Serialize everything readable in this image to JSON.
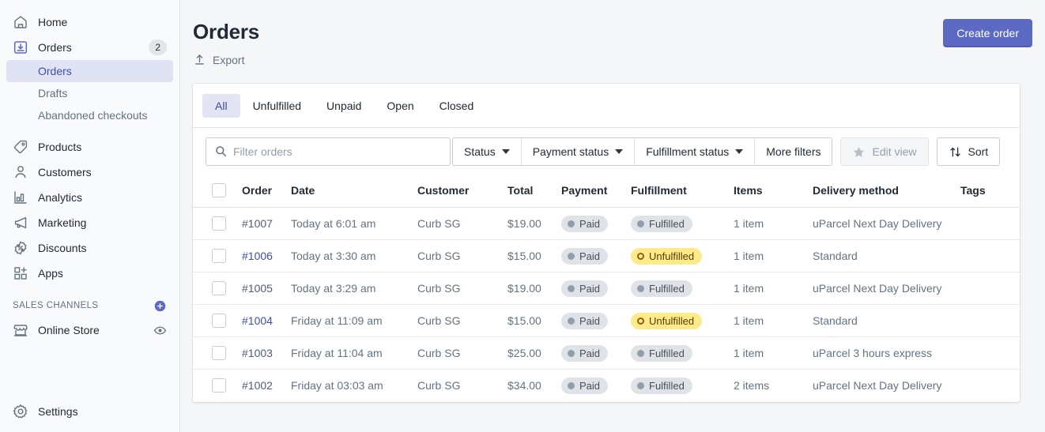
{
  "sidebar": {
    "items": [
      {
        "id": "home",
        "label": "Home",
        "icon": "home-icon",
        "badge": null
      },
      {
        "id": "orders",
        "label": "Orders",
        "icon": "orders-icon",
        "badge": "2"
      },
      {
        "id": "products",
        "label": "Products",
        "icon": "tag-icon",
        "badge": null
      },
      {
        "id": "customers",
        "label": "Customers",
        "icon": "person-icon",
        "badge": null
      },
      {
        "id": "analytics",
        "label": "Analytics",
        "icon": "bar-chart-icon",
        "badge": null
      },
      {
        "id": "marketing",
        "label": "Marketing",
        "icon": "megaphone-icon",
        "badge": null
      },
      {
        "id": "discounts",
        "label": "Discounts",
        "icon": "discount-icon",
        "badge": null
      },
      {
        "id": "apps",
        "label": "Apps",
        "icon": "apps-icon",
        "badge": null
      }
    ],
    "sub_items": [
      {
        "id": "orders",
        "label": "Orders",
        "active": true
      },
      {
        "id": "drafts",
        "label": "Drafts",
        "active": false
      },
      {
        "id": "abandoned",
        "label": "Abandoned checkouts",
        "active": false
      }
    ],
    "sales_channels": {
      "heading": "SALES CHANNELS",
      "add_icon": "plus-circle-icon",
      "items": [
        {
          "id": "online-store",
          "label": "Online Store",
          "icon": "store-icon",
          "action_icon": "eye-icon"
        }
      ]
    },
    "settings": {
      "label": "Settings",
      "icon": "gear-icon"
    },
    "colors": {
      "active_bg": "#dfe3f3",
      "active_text": "#3d4eac",
      "bg": "#f9fafb"
    }
  },
  "header": {
    "title": "Orders",
    "export_label": "Export",
    "export_icon": "export-icon",
    "create_order_label": "Create order",
    "primary_color": "#5c6ac4"
  },
  "tabs": [
    {
      "label": "All",
      "active": true
    },
    {
      "label": "Unfulfilled",
      "active": false
    },
    {
      "label": "Unpaid",
      "active": false
    },
    {
      "label": "Open",
      "active": false
    },
    {
      "label": "Closed",
      "active": false
    }
  ],
  "filters": {
    "search_placeholder": "Filter orders",
    "search_value": "",
    "search_icon": "search-icon",
    "dropdowns": [
      {
        "label": "Status"
      },
      {
        "label": "Payment status"
      },
      {
        "label": "Fulfillment status"
      }
    ],
    "more_filters_label": "More filters",
    "edit_view_label": "Edit view",
    "edit_view_icon": "star-icon",
    "edit_view_disabled": true,
    "sort_label": "Sort",
    "sort_icon": "sort-arrows-icon"
  },
  "table": {
    "columns": [
      {
        "key": "checkbox",
        "label": ""
      },
      {
        "key": "order",
        "label": "Order"
      },
      {
        "key": "date",
        "label": "Date"
      },
      {
        "key": "customer",
        "label": "Customer"
      },
      {
        "key": "total",
        "label": "Total"
      },
      {
        "key": "payment",
        "label": "Payment"
      },
      {
        "key": "fulfillment",
        "label": "Fulfillment"
      },
      {
        "key": "items",
        "label": "Items"
      },
      {
        "key": "delivery",
        "label": "Delivery method"
      },
      {
        "key": "tags",
        "label": "Tags"
      }
    ],
    "rows": [
      {
        "order": "#1007",
        "order_state": "visited",
        "date": "Today at 6:01 am",
        "date_state": "muted",
        "customer": "Curb SG",
        "total": "$19.00",
        "payment": "Paid",
        "payment_style": "gray",
        "fulfillment": "Fulfilled",
        "fulfillment_style": "gray",
        "items": "1 item",
        "items_state": "muted",
        "delivery": "uParcel Next Day Delivery",
        "delivery_state": "muted",
        "tags": ""
      },
      {
        "order": "#1006",
        "order_state": "link",
        "date": "Today at 3:30 am",
        "date_state": "dark",
        "customer": "Curb SG",
        "total": "$15.00",
        "payment": "Paid",
        "payment_style": "gray",
        "fulfillment": "Unfulfilled",
        "fulfillment_style": "yellow",
        "items": "1 item",
        "items_state": "dark",
        "delivery": "Standard",
        "delivery_state": "dark",
        "tags": ""
      },
      {
        "order": "#1005",
        "order_state": "visited",
        "date": "Today at 3:29 am",
        "date_state": "muted",
        "customer": "Curb SG",
        "total": "$19.00",
        "payment": "Paid",
        "payment_style": "gray",
        "fulfillment": "Fulfilled",
        "fulfillment_style": "gray",
        "items": "1 item",
        "items_state": "muted",
        "delivery": "uParcel Next Day Delivery",
        "delivery_state": "muted",
        "tags": ""
      },
      {
        "order": "#1004",
        "order_state": "link",
        "date": "Friday at 11:09 am",
        "date_state": "dark",
        "customer": "Curb SG",
        "total": "$15.00",
        "payment": "Paid",
        "payment_style": "gray",
        "fulfillment": "Unfulfilled",
        "fulfillment_style": "yellow",
        "items": "1 item",
        "items_state": "dark",
        "delivery": "Standard",
        "delivery_state": "dark",
        "tags": ""
      },
      {
        "order": "#1003",
        "order_state": "visited",
        "date": "Friday at 11:04 am",
        "date_state": "muted",
        "customer": "Curb SG",
        "total": "$25.00",
        "payment": "Paid",
        "payment_style": "gray",
        "fulfillment": "Fulfilled",
        "fulfillment_style": "gray",
        "items": "1 item",
        "items_state": "muted",
        "delivery": "uParcel 3 hours express",
        "delivery_state": "muted",
        "tags": ""
      },
      {
        "order": "#1002",
        "order_state": "visited",
        "date": "Friday at 03:03 am",
        "date_state": "muted",
        "customer": "Curb SG",
        "total": "$34.00",
        "payment": "Paid",
        "payment_style": "gray",
        "fulfillment": "Fulfilled",
        "fulfillment_style": "gray",
        "items": "2 items",
        "items_state": "muted",
        "delivery": "uParcel Next Day Delivery",
        "delivery_state": "muted",
        "tags": ""
      }
    ]
  }
}
